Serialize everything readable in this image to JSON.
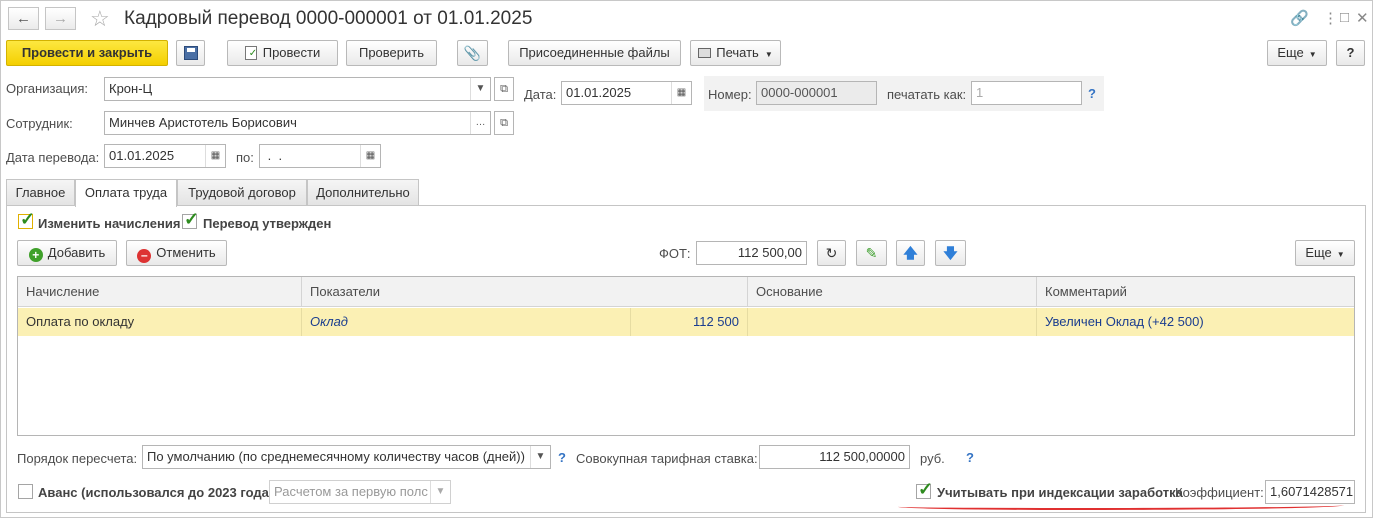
{
  "title": "Кадровый перевод 0000-000001 от 01.01.2025",
  "toolbar": {
    "post_close": "Провести и закрыть",
    "post": "Провести",
    "check": "Проверить",
    "attached": "Присоединенные файлы",
    "print": "Печать",
    "more": "Еще",
    "help": "?"
  },
  "form": {
    "org_label": "Организация:",
    "org_value": "Крон-Ц",
    "date_label": "Дата:",
    "date_value": "01.01.2025",
    "number_label": "Номер:",
    "number_value": "0000-000001",
    "print_as_label": "печатать как:",
    "print_as_value": "1",
    "employee_label": "Сотрудник:",
    "employee_value": "Минчев Аристотель Борисович",
    "transfer_date_label": "Дата перевода:",
    "transfer_date_value": "01.01.2025",
    "to_label": "по:",
    "to_value": " .  ."
  },
  "tabs": [
    "Главное",
    "Оплата труда",
    "Трудовой договор",
    "Дополнительно"
  ],
  "pay": {
    "change_accruals": "Изменить начисления",
    "approved": "Перевод утвержден",
    "add": "Добавить",
    "cancel": "Отменить",
    "fot_label": "ФОТ:",
    "fot_value": "112 500,00",
    "more": "Еще",
    "columns": [
      "Начисление",
      "Показатели",
      "Основание",
      "Комментарий"
    ],
    "rows": [
      {
        "accrual": "Оплата по окладу",
        "indicator": "Оклад",
        "amount": "112 500",
        "basis": "",
        "comment": "Увеличен Оклад (+42 500)"
      }
    ],
    "recalc_label": "Порядок пересчета:",
    "recalc_value": "По умолчанию (по среднемесячному количеству часов (дней))",
    "tariff_label": "Совокупная тарифная ставка:",
    "tariff_value": "112 500,00000",
    "currency": "руб.",
    "advance_label": "Аванс (использовался до 2023 года)",
    "advance_value": "Расчетом за первую полс",
    "indexation_label": "Учитывать при индексации заработка",
    "coef_label": "Коэффициент:",
    "coef_value": "1,6071428571"
  }
}
